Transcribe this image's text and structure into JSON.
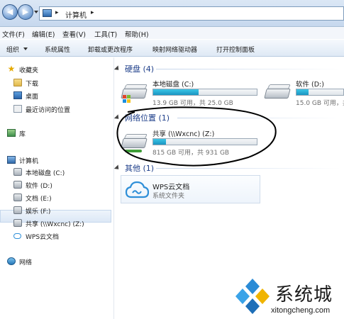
{
  "address_bar": {
    "crumb": "计算机",
    "sep1": "▸",
    "sep2": "▸"
  },
  "menu": [
    "文件(F)",
    "编辑(E)",
    "查看(V)",
    "工具(T)",
    "帮助(H)"
  ],
  "commands": [
    "组织",
    "系统属性",
    "卸载或更改程序",
    "映射网络驱动器",
    "打开控制面板"
  ],
  "nav": {
    "favorites": "收藏夹",
    "downloads": "下载",
    "desktop": "桌面",
    "recent": "最近访问的位置",
    "libraries": "库",
    "computer": "计算机",
    "drive_c": "本地磁盘 (C:)",
    "drive_d": "软件 (D:)",
    "drive_e": "文档 (E:)",
    "drive_f": "娱乐 (F:)",
    "drive_z": "共享 (\\\\Wxcnc) (Z:)",
    "wps": "WPS云文档",
    "network": "网络"
  },
  "sections": {
    "hdd": "硬盘 (4)",
    "network": "网络位置 (1)",
    "other": "其他 (1)"
  },
  "drives": {
    "c": {
      "name": "本地磁盘 (C:)",
      "info": "13.9 GB 可用，共 25.0 GB",
      "used_fraction": 0.44
    },
    "d": {
      "name": "软件 (D:)",
      "info": "15.0 GB 可用，共",
      "used_fraction": 0.25
    },
    "z": {
      "name": "共享 (\\\\Wxcnc) (Z:)",
      "info": "815 GB 可用，共 931 GB",
      "used_fraction": 0.12
    }
  },
  "wps_tile": {
    "title": "WPS云文档",
    "subtitle": "系统文件夹"
  },
  "watermark": {
    "title": "系统城",
    "url": "xitongcheng.com"
  },
  "colors": {
    "bar_fill": "#1a95c2",
    "section_text": "#1e3f8a",
    "wps_blue": "#2f8fd8"
  }
}
